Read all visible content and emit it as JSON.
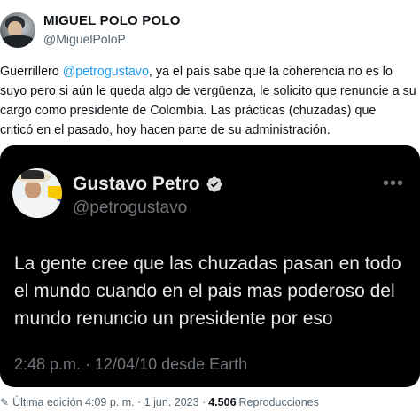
{
  "header": {
    "display_name": "MIGUEL POLO POLO",
    "handle": "@MiguelPoloP"
  },
  "tweet": {
    "line1_prefix": "Guerrillero ",
    "mention": "@petrogustavo",
    "line1_suffix": ", ya el país sabe que la coherencia no es lo",
    "line2": "suyo pero si aún le queda algo de vergüenza, le solicito que renuncie a su",
    "line3": "cargo como presidente de Colombia. Las prácticas (chuzadas) que",
    "line4": "criticó en el pasado, hoy hacen parte de su administración."
  },
  "embedded": {
    "display_name": "Gustavo Petro",
    "handle": "@petrogustavo",
    "text_line1": "La gente cree que las chuzadas pasan en todo",
    "text_line2": "el mundo cuando en el pais mas poderoso del",
    "text_line3": "mundo renuncio un presidente por eso",
    "timestamp": "2:48 p.m. · 12/04/10 desde Earth",
    "more_icon": "ellipsis-icon",
    "verified_color": "#d9d9d9"
  },
  "footer": {
    "edit_icon": "pencil-icon",
    "edited_label": "Última edición 4:09 p. m. · 1 jun. 2023 ·",
    "views_count": "4.506",
    "views_label": "Reproducciones"
  },
  "colors": {
    "mention": "#1d9bf0",
    "card_bg": "#000000",
    "secondary_text": "#536471"
  }
}
